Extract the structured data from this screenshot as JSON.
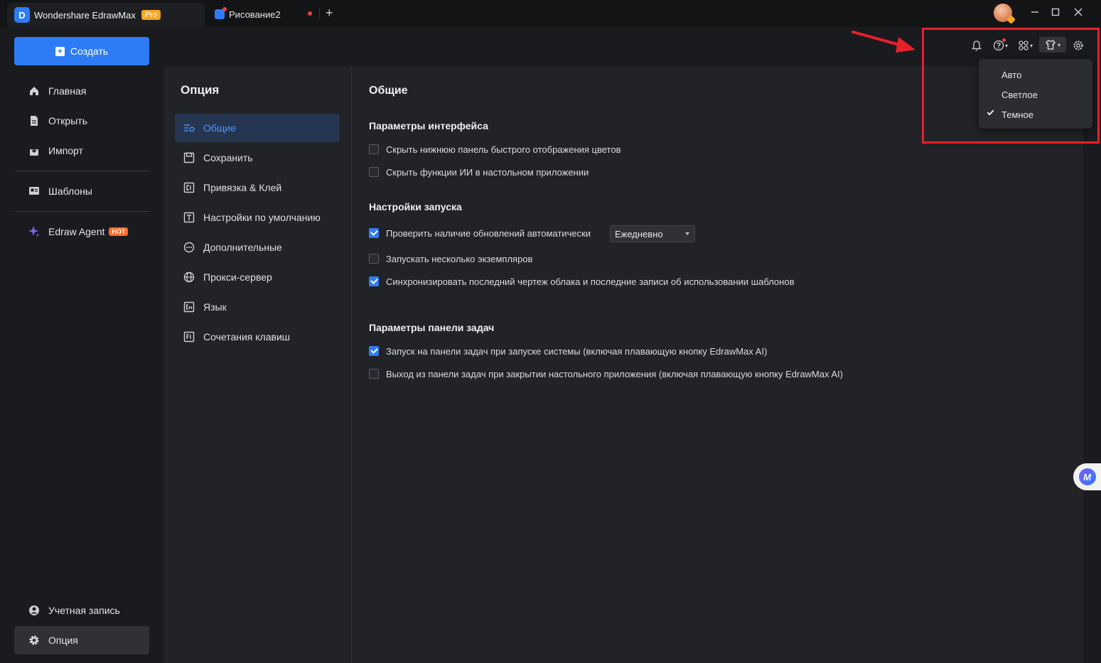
{
  "window": {
    "app_title": "Wondershare EdrawMax",
    "pro_badge": "Pro",
    "doc_tab": "Рисование2",
    "add_tab": "+"
  },
  "sidebar": {
    "create_label": "Создать",
    "items": [
      {
        "label": "Главная",
        "icon": "home-icon"
      },
      {
        "label": "Открыть",
        "icon": "file-icon"
      },
      {
        "label": "Импорт",
        "icon": "import-icon"
      },
      {
        "label": "Шаблоны",
        "icon": "templates-icon"
      },
      {
        "label": "Edraw Agent",
        "icon": "sparkle-icon",
        "badge": "HOT"
      }
    ],
    "bottom": [
      {
        "label": "Учетная запись",
        "icon": "user-icon"
      },
      {
        "label": "Опция",
        "icon": "gear-icon",
        "active": true
      }
    ]
  },
  "options": {
    "title": "Опция",
    "items": [
      {
        "label": "Общие",
        "icon": "general-settings-icon",
        "active": true
      },
      {
        "label": "Сохранить",
        "icon": "save-icon"
      },
      {
        "label": "Привязка & Клей",
        "icon": "snap-icon"
      },
      {
        "label": "Настройки по умолчанию",
        "icon": "text-default-icon"
      },
      {
        "label": "Дополнительные",
        "icon": "more-icon"
      },
      {
        "label": "Прокси-сервер",
        "icon": "globe-icon"
      },
      {
        "label": "Язык",
        "icon": "language-icon"
      },
      {
        "label": "Сочетания клавиш",
        "icon": "shortcut-icon"
      }
    ]
  },
  "content": {
    "title": "Общие",
    "sections": {
      "interface": {
        "title": "Параметры интерфейса",
        "items": [
          {
            "label": "Скрыть нижнюю панель быстрого отображения цветов",
            "checked": false
          },
          {
            "label": "Скрыть функции ИИ в настольном приложении",
            "checked": false
          }
        ]
      },
      "startup": {
        "title": "Настройки запуска",
        "items": [
          {
            "label": "Проверить наличие обновлений автоматически",
            "checked": true
          },
          {
            "label": "Запускать несколько экземпляров",
            "checked": false
          },
          {
            "label": "Синхронизировать последний чертеж облака и последние записи об использовании шаблонов",
            "checked": true
          }
        ],
        "update_frequency": "Ежедневно"
      },
      "taskbar": {
        "title": "Параметры панели задач",
        "items": [
          {
            "label": "Запуск на панели задач при запуске системы (включая плавающую кнопку EdrawMax AI)",
            "checked": true
          },
          {
            "label": "Выход из панели задач при закрытии настольного приложения (включая плавающую кнопку EdrawMax AI)",
            "checked": false
          }
        ]
      }
    }
  },
  "theme_menu": {
    "items": [
      {
        "label": "Авто",
        "checked": false
      },
      {
        "label": "Светлое",
        "checked": false
      },
      {
        "label": "Темное",
        "checked": true
      }
    ]
  },
  "colors": {
    "accent": "#2d7cf6",
    "highlight": "#e8202a",
    "background": "#1a1b1e",
    "panel": "#222327"
  }
}
